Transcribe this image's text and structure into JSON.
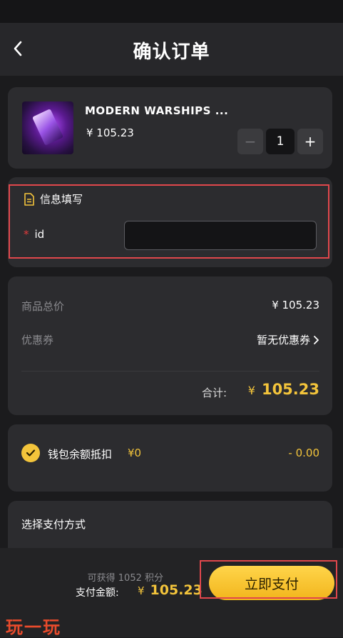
{
  "header": {
    "title": "确认订单"
  },
  "product": {
    "name": "MODERN WARSHIPS ...",
    "price": "¥ 105.23",
    "quantity": "1",
    "minus": "−",
    "plus": "+"
  },
  "info": {
    "title": "信息填写",
    "required_mark": "*",
    "id_label": "id",
    "id_value": ""
  },
  "summary": {
    "total_label": "商品总价",
    "total_value": "¥ 105.23",
    "coupon_label": "优惠券",
    "coupon_value": "暂无优惠券",
    "sum_label": "合计:",
    "sum_currency": "¥",
    "sum_value": "105.23"
  },
  "wallet": {
    "label": "钱包余额抵扣",
    "balance": "¥0",
    "deduction": "- 0.00"
  },
  "payment_method": {
    "title": "选择支付方式"
  },
  "bottom": {
    "points": "可获得 1052 积分",
    "pay_label": "支付金额:",
    "pay_currency": "¥",
    "pay_value": "105.23",
    "pay_button": "立即支付"
  },
  "watermark": {
    "text": "玩一玩"
  },
  "colors": {
    "accent": "#f3c43b",
    "highlight": "#e0474c",
    "card": "#2c2c2f",
    "background": "#1b1b1d"
  }
}
